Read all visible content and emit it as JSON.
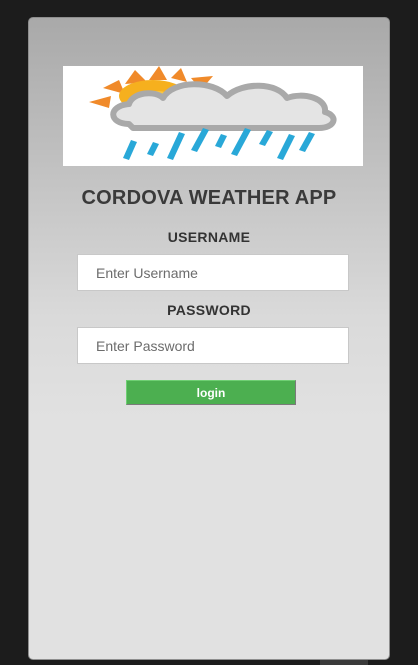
{
  "app": {
    "title": "CORDOVA WEATHER APP",
    "logo_icon": "weather-sun-cloud-rain-icon"
  },
  "login_form": {
    "username_label": "USERNAME",
    "username_placeholder": "Enter Username",
    "username_value": "",
    "password_label": "PASSWORD",
    "password_placeholder": "Enter Password",
    "password_value": "",
    "login_label": "login"
  },
  "colors": {
    "login_button": "#4caf50",
    "sun": "#f08a2a",
    "cloud": "#e6e6e6",
    "rain": "#29a8d8",
    "frame": "#1c1c1c"
  }
}
